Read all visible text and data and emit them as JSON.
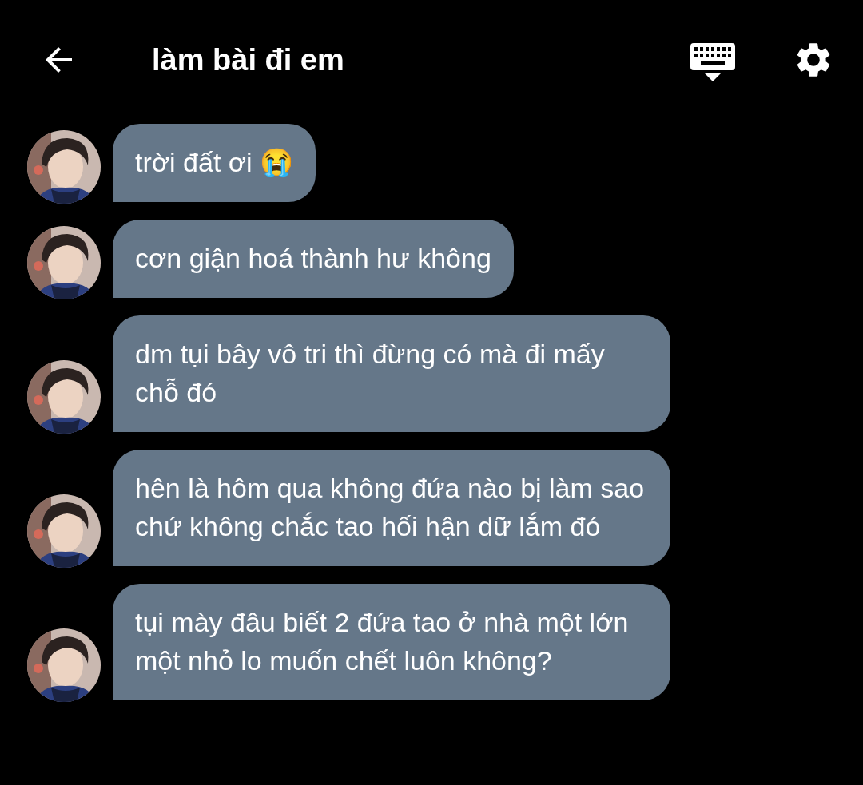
{
  "header": {
    "title": "làm bài đi em"
  },
  "messages": [
    {
      "text": "trời đất ơi 😭"
    },
    {
      "text": "cơn giận hoá thành hư không"
    },
    {
      "text": "dm tụi bây vô tri thì đừng có mà đi mấy chỗ đó"
    },
    {
      "text": "hên là hôm qua không đứa nào bị làm sao chứ không chắc tao hối hận dữ lắm đó"
    },
    {
      "text": "tụi mày đâu biết 2 đứa tao ở nhà một lớn một nhỏ lo muốn chết luôn không?"
    }
  ]
}
